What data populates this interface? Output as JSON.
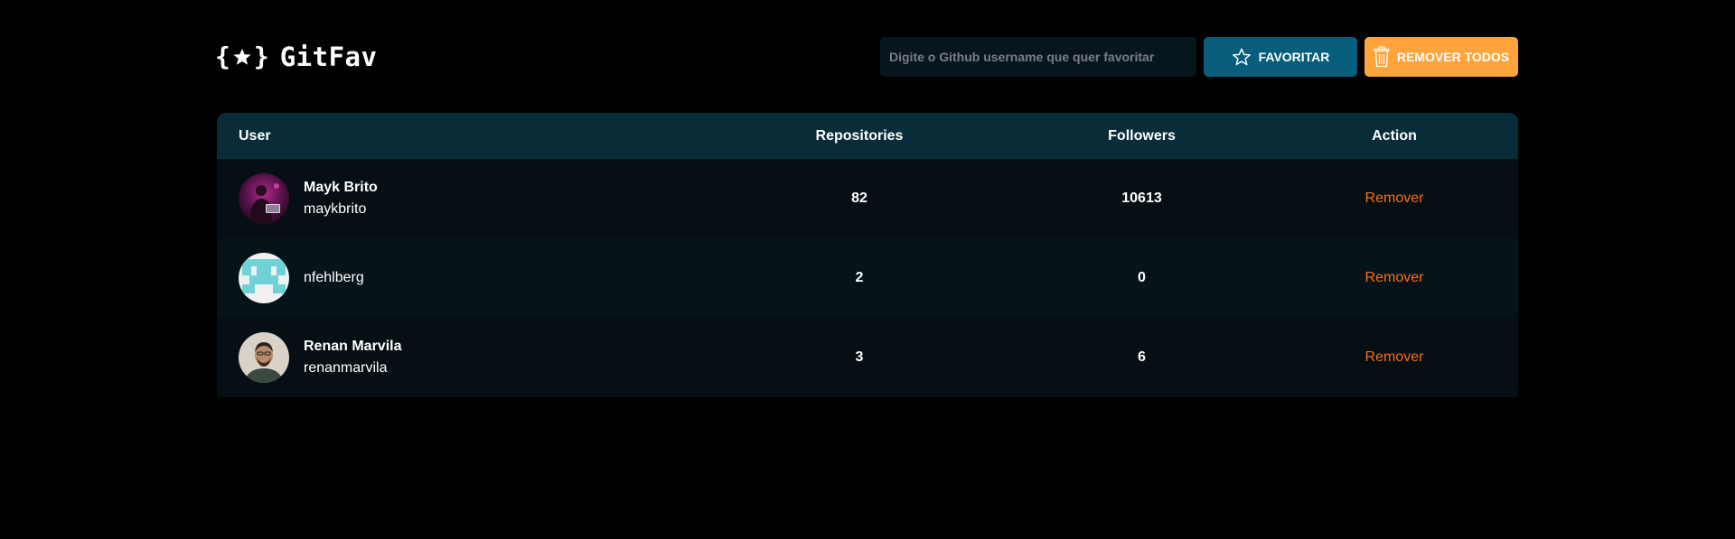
{
  "header": {
    "logo_text": "GitFav",
    "search": {
      "placeholder": "Digite o Github username que quer favoritar",
      "value": ""
    },
    "favorite_button_label": "FAVORITAR",
    "remove_all_button_label": "REMOVER TODOS"
  },
  "table": {
    "columns": [
      "User",
      "Repositories",
      "Followers",
      "Action"
    ],
    "rows": [
      {
        "name": "Mayk Brito",
        "login": "maykbrito",
        "repositories": "82",
        "followers": "10613",
        "action": "Remover"
      },
      {
        "name": "",
        "login": "nfehlberg",
        "repositories": "2",
        "followers": "0",
        "action": "Remover"
      },
      {
        "name": "Renan Marvila",
        "login": "renanmarvila",
        "repositories": "3",
        "followers": "6",
        "action": "Remover"
      }
    ]
  },
  "colors": {
    "background": "#000000",
    "header_row": "#092d38",
    "favorite_button": "#065e7c",
    "remove_all_button": "#ffa43a",
    "remove_link": "#f76e18"
  },
  "icons": [
    "star-logo-icon",
    "star-icon",
    "trash-icon"
  ]
}
